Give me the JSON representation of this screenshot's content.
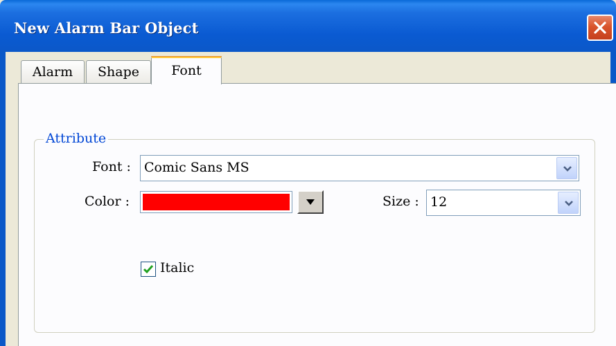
{
  "window": {
    "title": "New Alarm Bar Object",
    "close_icon": "close-icon"
  },
  "tabs": [
    {
      "label": "Alarm"
    },
    {
      "label": "Shape"
    },
    {
      "label": "Font",
      "selected": true
    }
  ],
  "attribute": {
    "group_label": "Attribute",
    "font_label": "Font :",
    "font_value": "Comic Sans MS",
    "color_label": "Color :",
    "color_value": "#ff0000",
    "size_label": "Size :",
    "size_value": "12",
    "italic_label": "Italic",
    "italic_checked": true
  },
  "colors": {
    "accent": "#0a58c8",
    "group_label": "#0046d5",
    "check": "#21a121"
  }
}
